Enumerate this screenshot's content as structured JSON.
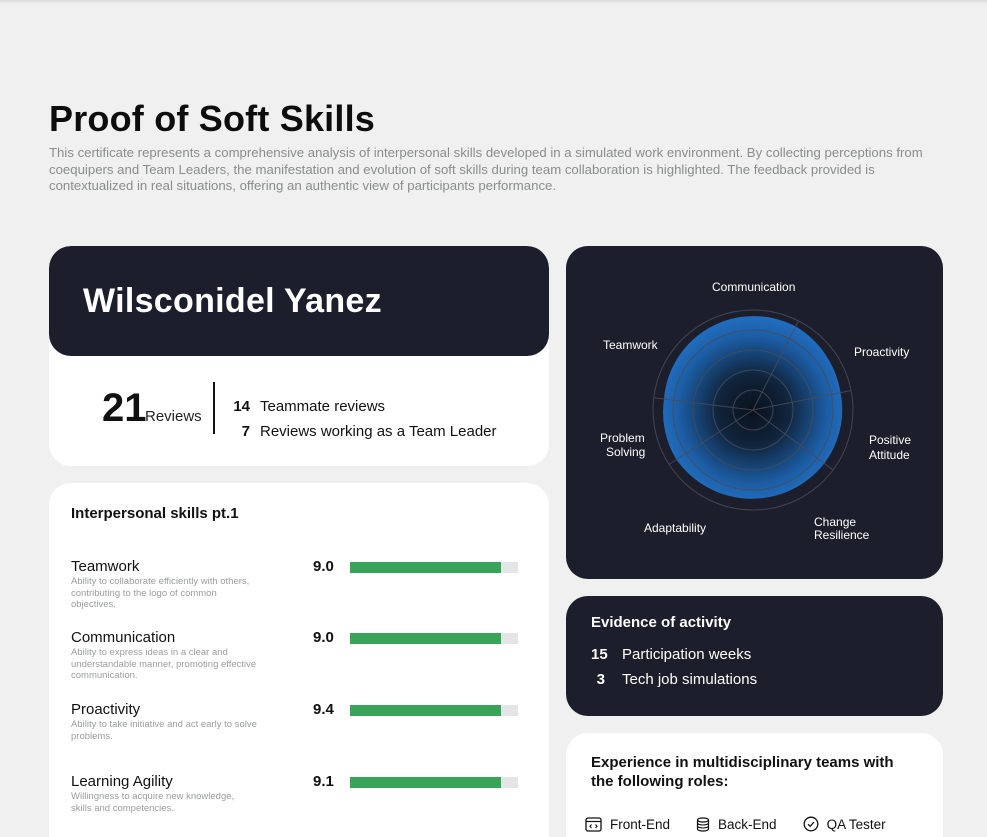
{
  "page": {
    "title": "Proof of Soft Skills",
    "description": "This certificate represents a comprehensive analysis of interpersonal skills developed in a simulated work environment. By collecting perceptions from coequipers and Team Leaders, the manifestation and evolution of soft skills during team collaboration is highlighted. The feedback provided is contextualized in real situations, offering an authentic view of participants performance."
  },
  "profile": {
    "name": "Wilsconidel Yanez",
    "total_reviews": "21",
    "total_reviews_label": "Reviews",
    "breakdown": [
      {
        "count": "14",
        "label": "Teammate reviews"
      },
      {
        "count": "7",
        "label": "Reviews working as a Team Leader"
      }
    ]
  },
  "skills": {
    "title": "Interpersonal skills pt.1",
    "items": [
      {
        "name": "Teamwork",
        "desc": "Ability to collaborate efficiently with others, contributing to the logo of common objectives.",
        "score": "9.0",
        "fill": 0.9
      },
      {
        "name": "Communication",
        "desc": "Ability to express ideas in a clear and understandable manner, promoting effective communication.",
        "score": "9.0",
        "fill": 0.9
      },
      {
        "name": "Proactivity",
        "desc": "Ability to take initiative and act early to solve problems.",
        "score": "9.4",
        "fill": 0.9
      },
      {
        "name": "Learning Agility",
        "desc": "Willingness to acquire new knowledge, skills and competencies.",
        "score": "9.1",
        "fill": 0.9
      }
    ]
  },
  "radar": {
    "labels": {
      "communication": "Communication",
      "proactivity": "Proactivity",
      "positive_attitude_1": "Positive",
      "positive_attitude_2": "Attitude",
      "change_resilience_1": "Change",
      "change_resilience_2": "Resilience",
      "adaptability": "Adaptability",
      "problem_solving_1": "Problem",
      "problem_solving_2": "Solving",
      "teamwork": "Teamwork"
    },
    "colors": {
      "fill_outer": "#2071c6",
      "fill_inner": "#0d1420",
      "grid": "#4a4e5c"
    }
  },
  "evidence": {
    "title": "Evidence of activity",
    "items": [
      {
        "count": "15",
        "label": "Participation weeks"
      },
      {
        "count": "3",
        "label": "Tech job simulations"
      }
    ]
  },
  "roles": {
    "title": "Experience in multidisciplinary teams with the following roles:",
    "items": [
      {
        "label": "Front-End",
        "icon": "code-window-icon"
      },
      {
        "label": "Back-End",
        "icon": "database-icon"
      },
      {
        "label": "QA Tester",
        "icon": "check-circle-icon"
      }
    ]
  }
}
